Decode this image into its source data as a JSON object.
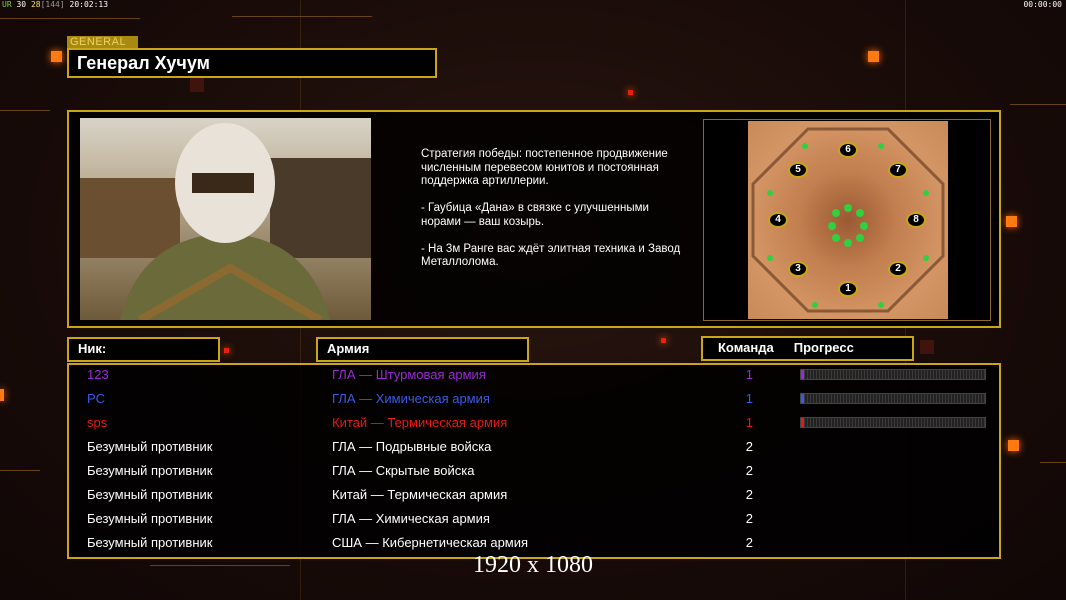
{
  "hud": {
    "fps_label": "UR",
    "fps1": "30",
    "fps2": "28",
    "frames": "[144]",
    "time": "20:02:13",
    "game_clock": "00:00:00"
  },
  "general": {
    "tag": "GENERAL",
    "name": "Генерал Хучум"
  },
  "strategy": "Стратегия победы: постепенное продвижение численным перевесом юнитов и постоянная поддержка артиллерии.\n\n- Гаубица «Дана» в связке с улучшенными норами — ваш козырь.\n\n- На 3м Ранге вас ждёт элитная техника и Завод Металлолома.",
  "map": {
    "start_positions": [
      "1",
      "2",
      "3",
      "4",
      "5",
      "6",
      "7",
      "8"
    ]
  },
  "headers": {
    "nick": "Ник:",
    "army": "Армия",
    "team": "Команда",
    "progress": "Прогресс"
  },
  "players": [
    {
      "nick": "123",
      "army": "ГЛА — Штурмовая армия",
      "team": "1",
      "color": "#9a2ad8",
      "progress": 0.01
    },
    {
      "nick": "PC",
      "army": "ГЛА — Химическая армия",
      "team": "1",
      "color": "#3b5ae8",
      "progress": 0.01
    },
    {
      "nick": "sps",
      "army": "Китай — Термическая армия",
      "team": "1",
      "color": "#e81818",
      "progress": 0.01
    },
    {
      "nick": "Безумный противник",
      "army": "ГЛА — Подрывные войска",
      "team": "2",
      "color": "#ffffff"
    },
    {
      "nick": "Безумный противник",
      "army": "ГЛА — Скрытые войска",
      "team": "2",
      "color": "#ffffff"
    },
    {
      "nick": "Безумный противник",
      "army": "Китай — Термическая армия",
      "team": "2",
      "color": "#ffffff"
    },
    {
      "nick": "Безумный противник",
      "army": "ГЛА — Химическая армия",
      "team": "2",
      "color": "#ffffff"
    },
    {
      "nick": "Безумный противник",
      "army": "США — Кибернетическая армия",
      "team": "2",
      "color": "#ffffff"
    }
  ],
  "resolution": "1920 x 1080"
}
